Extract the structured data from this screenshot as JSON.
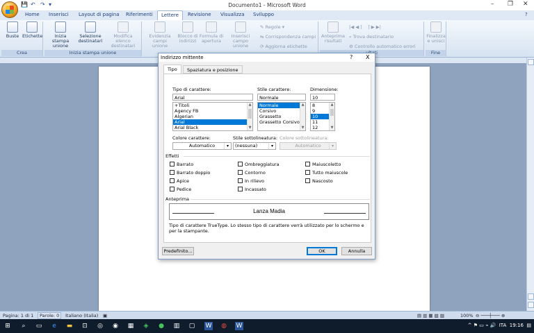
{
  "app": {
    "window_title": "Documento1 - Microsoft Word"
  },
  "ribbon_tabs": [
    "Home",
    "Inserisci",
    "Layout di pagina",
    "Riferimenti",
    "Lettere",
    "Revisione",
    "Visualizza",
    "Sviluppo"
  ],
  "active_tab": "Lettere",
  "ribbon": {
    "crea": {
      "label": "Crea",
      "buste": "Buste",
      "etichette": "Etichette"
    },
    "inizia": {
      "label": "Inizia stampa unione",
      "inizia_l1": "Inizia stampa",
      "inizia_l2": "unione",
      "sel_l1": "Selezione",
      "sel_l2": "destinatari",
      "mod_l1": "Modifica elenco",
      "mod_l2": "destinatari"
    },
    "scrivi": {
      "evid_l1": "Evidenzia",
      "evid_l2": "campi unione",
      "blocco_l1": "Blocco di",
      "blocco_l2": "indirizzi",
      "formula_l1": "Formula di",
      "formula_l2": "apertura",
      "inserisci_l1": "Inserisci campo",
      "inserisci_l2": "unione",
      "regole": "Regole",
      "corrisp": "Corrispondenza campi",
      "aggiorna": "Aggiorna etichette"
    },
    "anteprima": {
      "ant_l1": "Anteprima",
      "ant_l2": "risultati",
      "trova": "Trova destinatario",
      "controllo": "Controllo automatico errori",
      "label": "ultati"
    },
    "fine": {
      "fin_l1": "Finalizza",
      "fin_l2": "e unisci",
      "label": "Fine"
    }
  },
  "status": {
    "page": "Pagina: 1 di 1",
    "words": "Parole: 0",
    "lang": "Italiano (Italia)",
    "zoom": "100%",
    "time": "19:16",
    "lang_tray": "ITA"
  },
  "dialog": {
    "title": "Indirizzo mittente",
    "help": "?",
    "close": "X",
    "tabs": [
      "Tipo",
      "Spaziatura e posizione"
    ],
    "font_label": "Tipo di carattere:",
    "font_value": "Arial",
    "font_list": [
      "+Titoli",
      "Agency FB",
      "Algerian",
      "Arial",
      "Arial Black"
    ],
    "font_selected": "Arial",
    "style_label": "Stile carattere:",
    "style_value": "Normale",
    "style_list": [
      "Normale",
      "Corsivo",
      "Grassetto",
      "Grassetto Corsivo"
    ],
    "style_selected": "Normale",
    "size_label": "Dimensione:",
    "size_value": "10",
    "size_list": [
      "8",
      "9",
      "10",
      "11",
      "12"
    ],
    "size_selected": "10",
    "color_label": "Colore carattere:",
    "color_value": "Automatico",
    "underline_label": "Stile sottolineatura:",
    "underline_value": "(nessuna)",
    "underline_color_label": "Colore sottolineatura:",
    "underline_color_value": "Automatico",
    "effects_label": "Effetti",
    "effects": [
      [
        "Barrato",
        "Ombreggiatura",
        "Maiuscoletto"
      ],
      [
        "Barrato doppio",
        "Contorno",
        "Tutto maiuscole"
      ],
      [
        "Apice",
        "In rilievo",
        "Nascosto"
      ],
      [
        "Pedice",
        "Incassato",
        ""
      ]
    ],
    "preview_label": "Anteprima",
    "preview_text": "Lanza Madia",
    "preview_note": "Tipo di carattere TrueType. Lo stesso tipo di carattere verrà utilizzato per lo schermo e per la stampante.",
    "default_btn": "Predefinito...",
    "ok_btn": "OK",
    "cancel_btn": "Annulla"
  }
}
